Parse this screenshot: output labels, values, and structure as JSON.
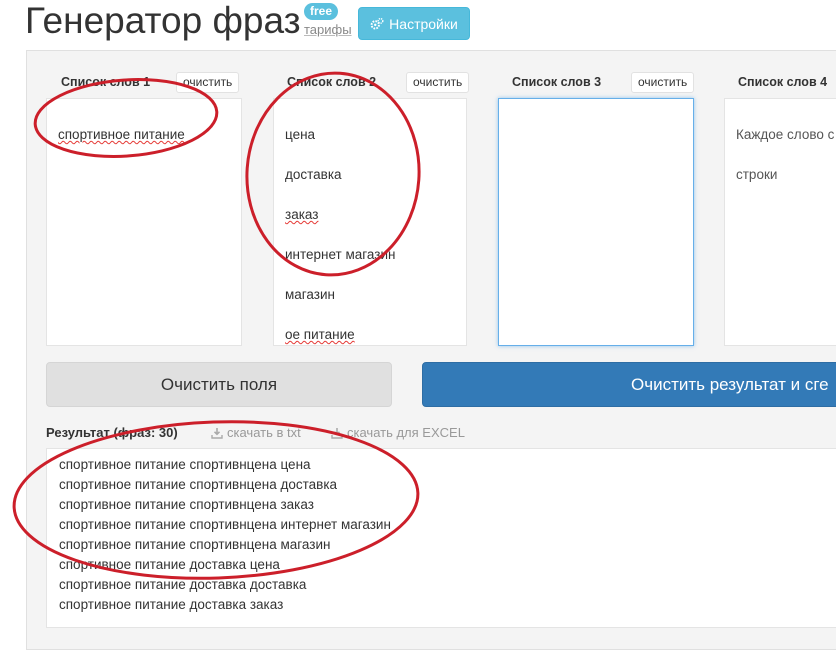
{
  "header": {
    "title": "Генератор фраз",
    "badge": "free",
    "plans_link": "тарифы",
    "settings_label": "Настройки",
    "settings_icon": "gears-icon"
  },
  "lists": [
    {
      "title": "Список слов 1",
      "clear_label": "очистить",
      "words": [
        "спортивное питание"
      ]
    },
    {
      "title": "Список слов 2",
      "clear_label": "очистить",
      "words": [
        "цена",
        "доставка",
        "заказ",
        "интернет магазин",
        "магазин",
        "ое питание"
      ]
    },
    {
      "title": "Список слов 3",
      "clear_label": "очистить",
      "words": []
    },
    {
      "title": "Список слов 4",
      "clear_label": "",
      "placeholder_lines": [
        "Каждое слово с",
        "строки"
      ]
    }
  ],
  "actions": {
    "clear_fields": "Очистить поля",
    "clear_result": "Очистить результат и сге"
  },
  "result": {
    "label": "Результат (фраз: 30)",
    "download_txt": "скачать в txt",
    "download_excel": "скачать для EXCEL",
    "download_icon": "download-icon",
    "lines": [
      "спортивное питание спортивнцена цена",
      "спортивное питание спортивнцена доставка",
      "спортивное питание спортивнцена заказ",
      "спортивное питание спортивнцена интернет магазин",
      "спортивное питание спортивнцена магазин",
      "спортивное питание доставка цена",
      "спортивное питание доставка доставка",
      "спортивное питание доставка заказ"
    ]
  },
  "colors": {
    "info": "#5bc0de",
    "primary": "#337ab7",
    "annotation": "#cc1f2a"
  }
}
